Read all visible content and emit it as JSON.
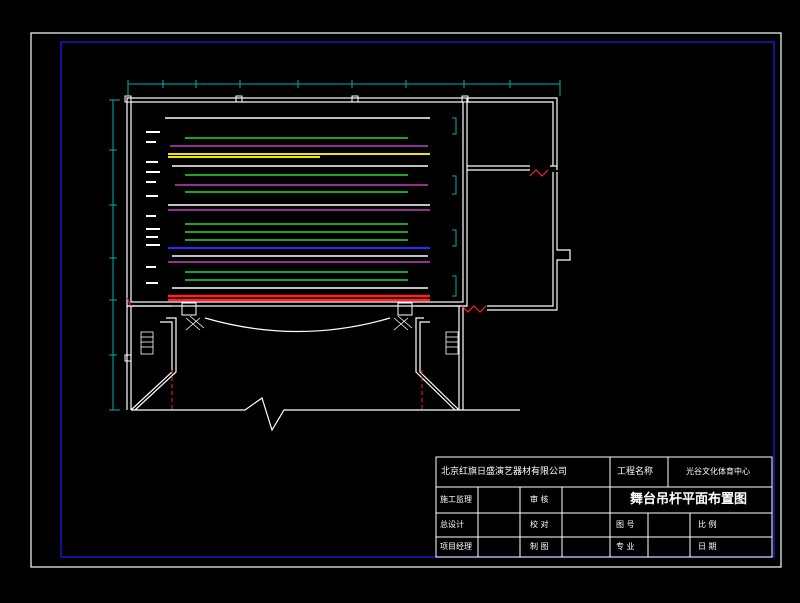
{
  "title_block": {
    "company": "北京红旗日盛演艺器材有限公司",
    "project_label": "工程名称",
    "project_name": "光谷文化体育中心",
    "drawing_title": "舞台吊杆平面布置图",
    "left_labels": [
      "施工监理",
      "总设计",
      "项目经理"
    ],
    "mid_labels": [
      "审 核",
      "校 对",
      "制 图"
    ],
    "right_labels": [
      "图 号",
      "比 例",
      "专 业",
      "日 期"
    ]
  },
  "colors": {
    "background": "#000000",
    "frame_outer": "#ffffff",
    "frame_inner": "#1a1ad8",
    "wall": "#ffffff",
    "dimension": "#00b0b0",
    "batten_white": "#ffffff",
    "batten_green": "#22dd22",
    "batten_magenta": "#c040c0",
    "batten_yellow": "#e8e800",
    "batten_blue": "#2a2aff",
    "batten_red": "#ff2222",
    "door_red": "#ff2222"
  }
}
